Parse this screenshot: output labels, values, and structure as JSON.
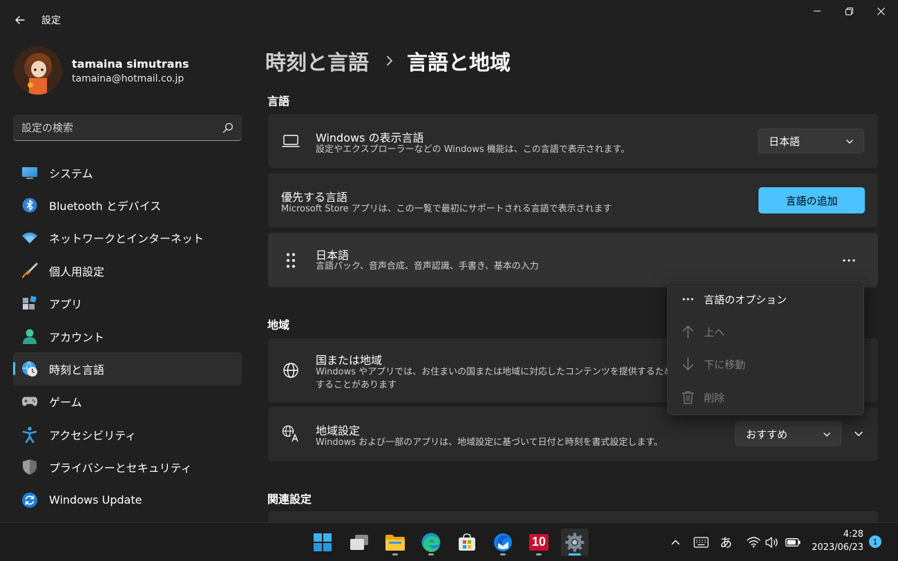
{
  "app": {
    "title": "設定"
  },
  "profile": {
    "name": "tamaina simutrans",
    "email": "tamaina@hotmail.co.jp"
  },
  "search": {
    "placeholder": "設定の検索"
  },
  "sidebar": {
    "items": [
      {
        "label": "システム",
        "icon": "system-icon"
      },
      {
        "label": "Bluetooth とデバイス",
        "icon": "bluetooth-icon"
      },
      {
        "label": "ネットワークとインターネット",
        "icon": "wifi-icon"
      },
      {
        "label": "個人用設定",
        "icon": "brush-icon"
      },
      {
        "label": "アプリ",
        "icon": "apps-icon"
      },
      {
        "label": "アカウント",
        "icon": "account-icon"
      },
      {
        "label": "時刻と言語",
        "icon": "time-language-icon",
        "selected": true
      },
      {
        "label": "ゲーム",
        "icon": "gamepad-icon"
      },
      {
        "label": "アクセシビリティ",
        "icon": "accessibility-icon"
      },
      {
        "label": "プライバシーとセキュリティ",
        "icon": "shield-icon"
      },
      {
        "label": "Windows Update",
        "icon": "update-icon"
      }
    ]
  },
  "header": {
    "parent": "時刻と言語",
    "current": "言語と地域"
  },
  "sections": {
    "language": {
      "label": "言語",
      "display_language": {
        "title": "Windows の表示言語",
        "desc": "設定やエクスプローラーなどの Windows 機能は、この言語で表示されます。",
        "value": "日本語"
      },
      "preferred": {
        "title": "優先する言語",
        "desc": "Microsoft Store アプリは、この一覧で最初にサポートされる言語で表示されます",
        "add_button": "言語の追加"
      },
      "japanese": {
        "title": "日本語",
        "desc": "言語パック、音声合成、音声認識、手書き、基本の入力"
      }
    },
    "region": {
      "label": "地域",
      "country": {
        "title": "国または地域",
        "desc_line1": "Windows やアプリでは、お住まいの国または地域に対応したコンテンツを提供するために、この",
        "desc_line2": "することがあります"
      },
      "format": {
        "title": "地域設定",
        "desc": "Windows および一部のアプリは、地域設定に基づいて日付と時刻を書式設定します。",
        "value": "おすすめ"
      }
    },
    "related": {
      "label": "関連設定"
    }
  },
  "context_menu": {
    "items": [
      {
        "label": "言語のオプション",
        "icon": "more-icon",
        "enabled": true
      },
      {
        "label": "上へ",
        "icon": "arrow-up-icon",
        "enabled": false
      },
      {
        "label": "下に移動",
        "icon": "arrow-down-icon",
        "enabled": false
      },
      {
        "label": "削除",
        "icon": "trash-icon",
        "enabled": false
      }
    ]
  },
  "taskbar": {
    "apps": [
      "start-icon",
      "task-view-icon",
      "file-explorer-icon",
      "edge-icon",
      "store-icon",
      "thunderbird-icon",
      "app-10-icon",
      "settings-icon"
    ],
    "app_10_label": "10",
    "ime": "あ",
    "time": "4:28",
    "date": "2023/06/23",
    "notifications": "1"
  },
  "colors": {
    "accent": "#4cc2ff",
    "background": "#202020",
    "card": "#2b2b2b"
  }
}
